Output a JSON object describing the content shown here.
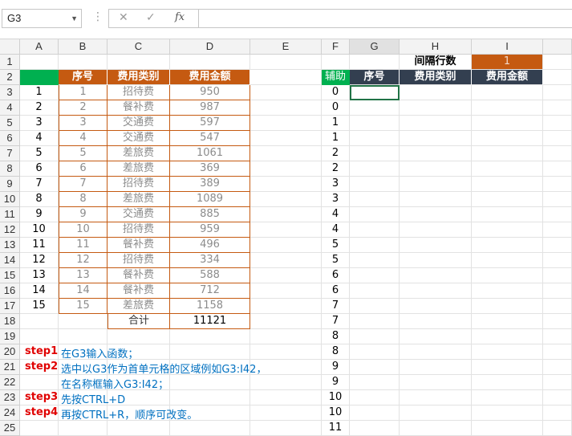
{
  "formula_bar": {
    "name_box": "G3",
    "cancel_icon": "✕",
    "enter_icon": "✓",
    "fx_label": "fx",
    "formula": ""
  },
  "columns": [
    "A",
    "B",
    "C",
    "D",
    "E",
    "F",
    "G",
    "H",
    "I"
  ],
  "rows": [
    "1",
    "2",
    "3",
    "4",
    "5",
    "6",
    "7",
    "8",
    "9",
    "10",
    "11",
    "12",
    "13",
    "14",
    "15",
    "16",
    "17",
    "18",
    "19",
    "20",
    "21",
    "22",
    "23",
    "24",
    "25"
  ],
  "table1": {
    "headers": [
      "序号",
      "费用类别",
      "费用金额"
    ],
    "a_values": [
      "1",
      "2",
      "3",
      "4",
      "5",
      "6",
      "7",
      "8",
      "9",
      "10",
      "11",
      "12",
      "13",
      "14",
      "15"
    ],
    "rows": [
      [
        "1",
        "招待费",
        "950"
      ],
      [
        "2",
        "餐补费",
        "987"
      ],
      [
        "3",
        "交通费",
        "597"
      ],
      [
        "4",
        "交通费",
        "547"
      ],
      [
        "5",
        "差旅费",
        "1061"
      ],
      [
        "6",
        "差旅费",
        "369"
      ],
      [
        "7",
        "招待费",
        "389"
      ],
      [
        "8",
        "差旅费",
        "1089"
      ],
      [
        "9",
        "交通费",
        "885"
      ],
      [
        "10",
        "招待费",
        "959"
      ],
      [
        "11",
        "餐补费",
        "496"
      ],
      [
        "12",
        "招待费",
        "334"
      ],
      [
        "13",
        "餐补费",
        "588"
      ],
      [
        "14",
        "餐补费",
        "712"
      ],
      [
        "15",
        "差旅费",
        "1158"
      ]
    ],
    "total_label": "合计",
    "total_value": "11121"
  },
  "helper": {
    "header": "辅助",
    "values": [
      "0",
      "0",
      "1",
      "1",
      "2",
      "2",
      "3",
      "3",
      "4",
      "4",
      "5",
      "5",
      "6",
      "6",
      "7",
      "7",
      "8",
      "8",
      "9",
      "9",
      "10",
      "10",
      "11"
    ]
  },
  "output": {
    "interval_label": "间隔行数",
    "interval_value": "1",
    "headers": [
      "序号",
      "费用类别",
      "费用金额"
    ]
  },
  "steps": [
    {
      "label": "step1",
      "text": "在G3输入函数；"
    },
    {
      "label": "step2",
      "text": "选中以G3作为首单元格的区域例如G3:I42，"
    },
    {
      "label": "",
      "text": "在名称框输入G3:I42；"
    },
    {
      "label": "step3",
      "text": "先按CTRL+D"
    },
    {
      "label": "step4",
      "text": "再按CTRL+R，顺序可改变。"
    }
  ],
  "colors": {
    "orange": "#C55A11",
    "navy": "#333F50",
    "green": "#00B050",
    "red": "#E00000",
    "blue": "#0070C0"
  }
}
